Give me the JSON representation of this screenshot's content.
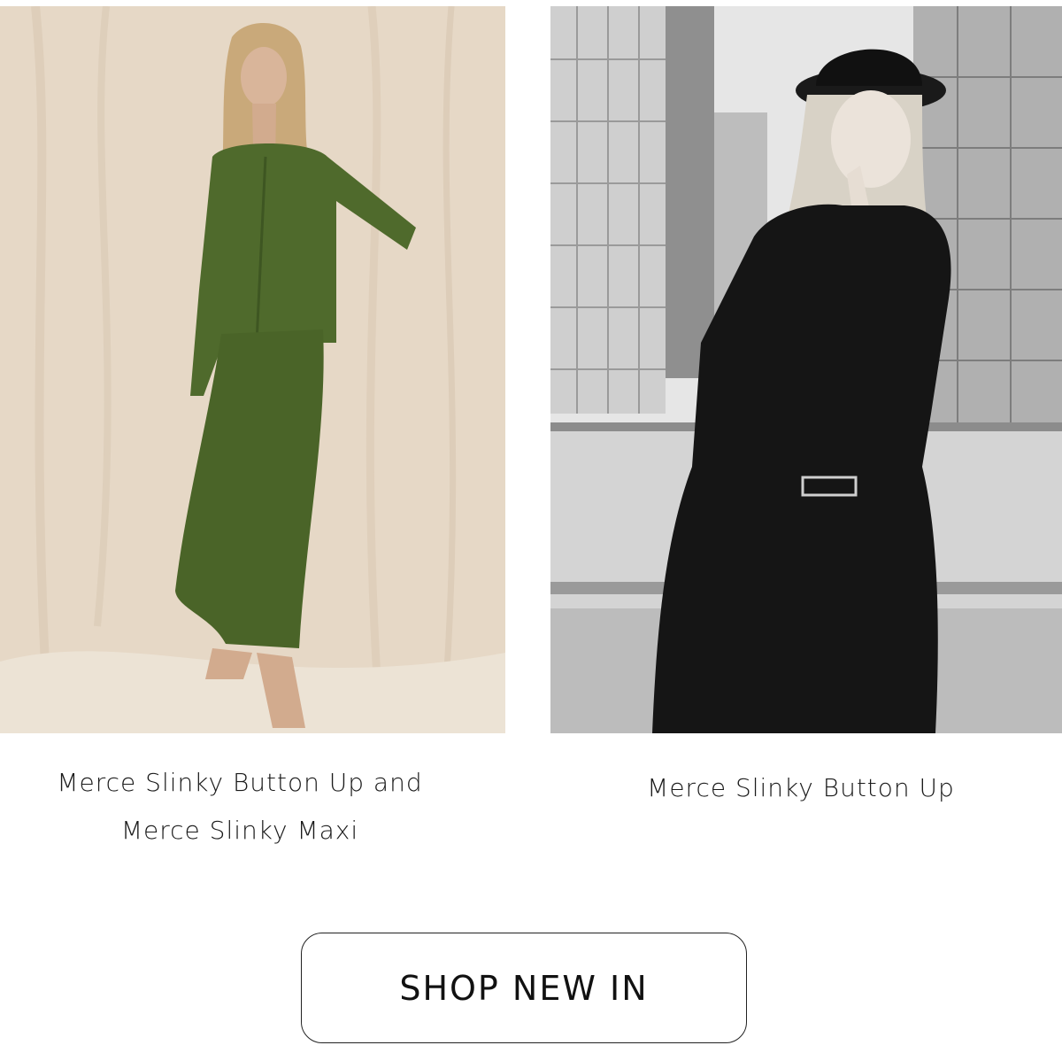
{
  "products": [
    {
      "caption_line1": "Merce Slinky Button Up and",
      "caption_line2": "Merce Slinky Maxi"
    },
    {
      "caption_line1": "Merce Slinky Button Up"
    }
  ],
  "cta": {
    "label": "SHOP NEW IN"
  },
  "colors": {
    "background": "#ffffff",
    "text": "#111111",
    "button_border": "#222222",
    "olive_outfit": "#4f6a2c",
    "backdrop": "#e6d8c6"
  }
}
